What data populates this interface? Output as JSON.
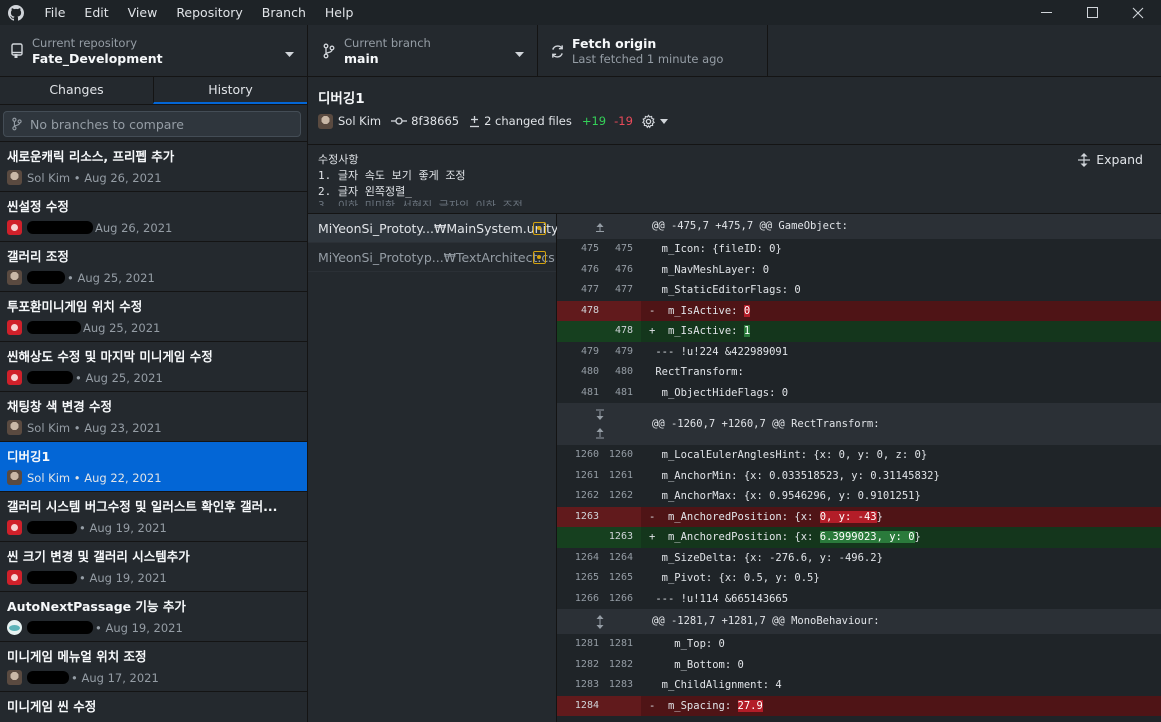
{
  "menu": [
    "File",
    "Edit",
    "View",
    "Repository",
    "Branch",
    "Help"
  ],
  "window": {
    "minimize": "—",
    "maximize": "☐",
    "close": "✕"
  },
  "toolbar": {
    "repo_label": "Current repository",
    "repo_name": "Fate_Development",
    "branch_label": "Current branch",
    "branch_name": "main",
    "fetch_label": "Fetch origin",
    "fetch_sub": "Last fetched 1 minute ago"
  },
  "tabs": {
    "changes": "Changes",
    "history": "History"
  },
  "compare_placeholder": "No branches to compare",
  "commits": [
    {
      "title": "새로운캐릭 리소스, 프리펩 추가",
      "author": "Sol Kim",
      "date": "Aug 26, 2021",
      "avatar": "photo"
    },
    {
      "title": "씬설정 수정",
      "author": "",
      "date": "Aug 26, 2021",
      "avatar": "red"
    },
    {
      "title": "갤러리 조정",
      "author": "",
      "date": "Aug 25, 2021",
      "avatar": "photo"
    },
    {
      "title": "투포환미니게임 위치 수정",
      "author": "",
      "date": "Aug 25, 2021",
      "avatar": "red"
    },
    {
      "title": "씬해상도 수정 및 마지막 미니게임 수정",
      "author": "",
      "date": "Aug 25, 2021",
      "avatar": "red"
    },
    {
      "title": "채팅창 색 변경 수정",
      "author": "Sol Kim",
      "date": "Aug 23, 2021",
      "avatar": "photo"
    },
    {
      "title": "디버깅1",
      "author": "Sol Kim",
      "date": "Aug 22, 2021",
      "avatar": "photo"
    },
    {
      "title": "갤러리 시스템 버그수정 및 일러스트 확인후 갤러...",
      "author": "",
      "date": "Aug 19, 2021",
      "avatar": "red"
    },
    {
      "title": "씬 크기 변경 및 갤러리 시스템추가",
      "author": "",
      "date": "Aug 19, 2021",
      "avatar": "red"
    },
    {
      "title": "AutoNextPassage 기능 추가",
      "author": "",
      "date": "Aug 19, 2021",
      "avatar": "teal"
    },
    {
      "title": "미니게임 메뉴얼 위치 조정",
      "author": "",
      "date": "Aug 17, 2021",
      "avatar": "photo"
    },
    {
      "title": "미니게임 씬 수정",
      "author": "",
      "date": "",
      "avatar": "red"
    }
  ],
  "commit_detail": {
    "title": "디버깅1",
    "author": "Sol Kim",
    "sha": "8f38665",
    "changed_files": "2 changed files",
    "additions": "+19",
    "deletions": "-19",
    "message_lines": [
      "수정사항",
      "1. 글자 속도 보기 좋게 조정",
      "2. 글자 왼쪽정렬_"
    ],
    "message_faded": "3. 이하 미미한 서현진 글자의 이하 조정",
    "expand": "Expand"
  },
  "files": [
    {
      "name": "MiYeonSi_Prototy...₩MainSystem.unity"
    },
    {
      "name": "MiYeonSi_Prototyp...₩TextArchitect.cs"
    }
  ],
  "diff": {
    "hunk1": "@@ -475,7 +475,7 @@ GameObject:",
    "hunk2": "@@ -1260,7 +1260,7 @@ RectTransform:",
    "hunk3": "@@ -1281,7 +1281,7 @@ MonoBehaviour:",
    "lines1": [
      {
        "a": "475",
        "b": "475",
        "t": "  m_Icon: {fileID: 0}"
      },
      {
        "a": "476",
        "b": "476",
        "t": "  m_NavMeshLayer: 0"
      },
      {
        "a": "477",
        "b": "477",
        "t": "  m_StaticEditorFlags: 0"
      }
    ],
    "del1": {
      "a": "478",
      "pre": "-  m_IsActive: ",
      "hl": "0",
      "post": ""
    },
    "add1": {
      "b": "478",
      "pre": "+  m_IsActive: ",
      "hl": "1",
      "post": ""
    },
    "lines2": [
      {
        "a": "479",
        "b": "479",
        "t": " --- !u!224 &422989091"
      },
      {
        "a": "480",
        "b": "480",
        "t": " RectTransform:"
      },
      {
        "a": "481",
        "b": "481",
        "t": "  m_ObjectHideFlags: 0"
      }
    ],
    "lines3": [
      {
        "a": "1260",
        "b": "1260",
        "t": "  m_LocalEulerAnglesHint: {x: 0, y: 0, z: 0}"
      },
      {
        "a": "1261",
        "b": "1261",
        "t": "  m_AnchorMin: {x: 0.033518523, y: 0.31145832}"
      },
      {
        "a": "1262",
        "b": "1262",
        "t": "  m_AnchorMax: {x: 0.9546296, y: 0.9101251}"
      }
    ],
    "del2": {
      "a": "1263",
      "pre": "-  m_AnchoredPosition: {x: ",
      "hl": "0, y: ",
      "hl2": "-43",
      "post": "}"
    },
    "add2": {
      "b": "1263",
      "pre": "+  m_AnchoredPosition: {x: ",
      "hl": "6.3999023, y: ",
      "hl2": "0",
      "post": "}"
    },
    "lines4": [
      {
        "a": "1264",
        "b": "1264",
        "t": "  m_SizeDelta: {x: -276.6, y: -496.2}"
      },
      {
        "a": "1265",
        "b": "1265",
        "t": "  m_Pivot: {x: 0.5, y: 0.5}"
      },
      {
        "a": "1266",
        "b": "1266",
        "t": " --- !u!114 &665143665"
      }
    ],
    "lines5": [
      {
        "a": "1281",
        "b": "1281",
        "t": "    m_Top: 0"
      },
      {
        "a": "1282",
        "b": "1282",
        "t": "    m_Bottom: 0"
      },
      {
        "a": "1283",
        "b": "1283",
        "t": "  m_ChildAlignment: 4"
      }
    ],
    "del3": {
      "a": "1284",
      "pre": "-  m_Spacing: ",
      "hl": "27.9",
      "post": ""
    }
  }
}
